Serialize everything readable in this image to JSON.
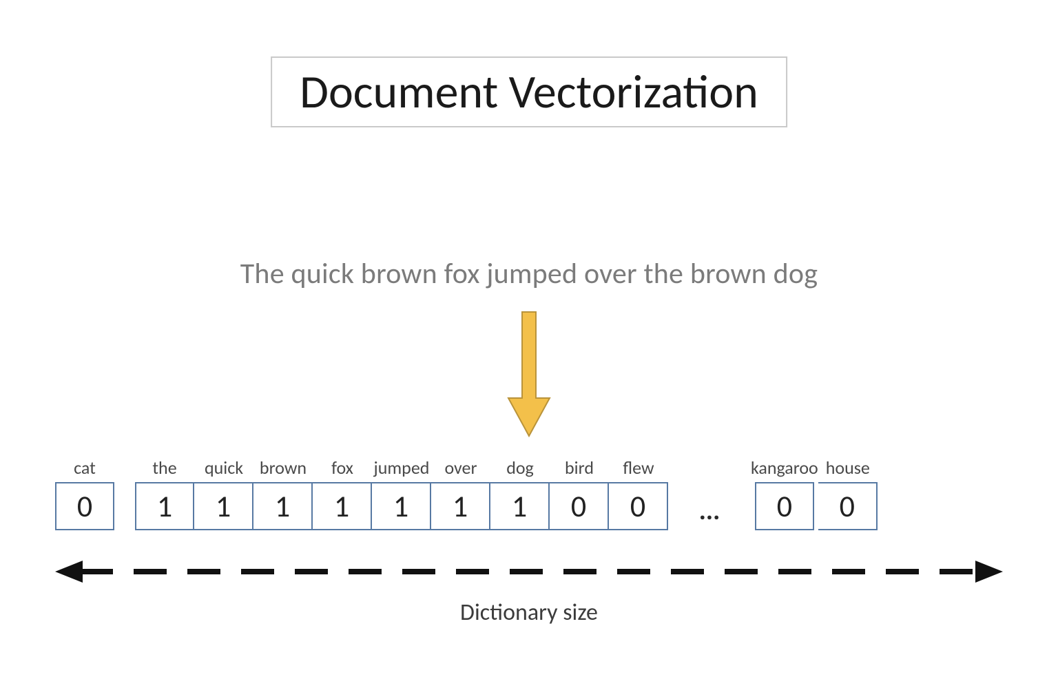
{
  "title": "Document Vectorization",
  "sentence": "The quick brown fox jumped over the brown dog",
  "vector": {
    "main_group": [
      {
        "word": "cat",
        "value": "0"
      },
      {
        "word": "the",
        "value": "1"
      },
      {
        "word": "quick",
        "value": "1"
      },
      {
        "word": "brown",
        "value": "1"
      },
      {
        "word": "fox",
        "value": "1"
      },
      {
        "word": "jumped",
        "value": "1"
      },
      {
        "word": "over",
        "value": "1"
      },
      {
        "word": "dog",
        "value": "1"
      },
      {
        "word": "bird",
        "value": "0"
      },
      {
        "word": "flew",
        "value": "0"
      }
    ],
    "ellipsis": "...",
    "tail_group": [
      {
        "word": "kangaroo",
        "value": "0"
      },
      {
        "word": "house",
        "value": "0"
      }
    ]
  },
  "axis_label": "Dictionary size",
  "colors": {
    "cell_border": "#5779a3",
    "arrow_fill": "#f3c04a",
    "arrow_stroke": "#b9933a",
    "title_border": "#c9c9c9",
    "sentence_color": "#7b7b7b"
  }
}
